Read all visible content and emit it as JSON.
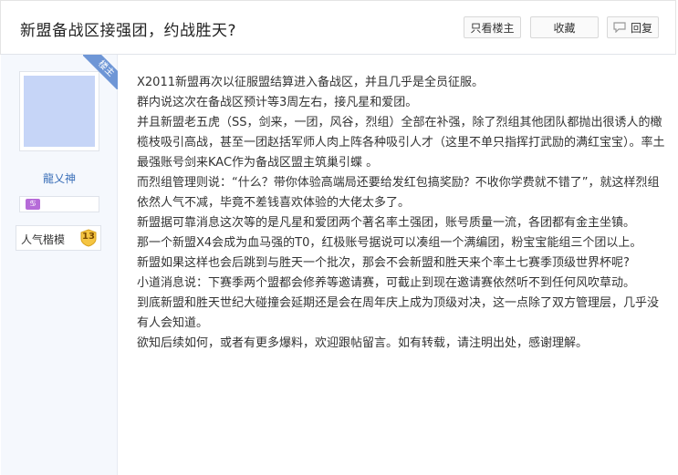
{
  "thread": {
    "title": "新盟备战区接强团，约战胜天?"
  },
  "toolbar": {
    "only_author_label": "只看楼主",
    "favorite_label": "收藏",
    "reply_label": "回复"
  },
  "author": {
    "badge": "楼主",
    "username": "龍乂神",
    "level_icon": "zodiac-icon",
    "popularity_label": "人气楷模",
    "popularity_value": "13"
  },
  "post": {
    "paragraphs": [
      "X2011新盟再次以征服盟结算进入备战区，并且几乎是全员征服。",
      "群内说这次在备战区预计等3周左右，接凡星和爱团。",
      "并且新盟老五虎（SS，剑来，一团，风谷，烈组）全部在补强，除了烈组其他团队都抛出很诱人的橄榄枝吸引高战，甚至一团赵括军师人肉上阵各种吸引人才（这里不单只指挥打武励的满红宝宝）。率土最强账号剑来KAC作为备战区盟主筑巢引蝶 。",
      "而烈组管理则说：“什么？带你体验高端局还要给发红包搞奖励？不收你学费就不错了”，就这样烈组依然人气不减，毕竟不差钱喜欢体验的大佬太多了。",
      "新盟据可靠消息这次等的是凡星和爱团两个著名率土强团，账号质量一流，各团都有金主坐镇。",
      "那一个新盟X4会成为血马强的T0，红极账号据说可以凑组一个满编团，粉宝宝能组三个团以上。",
      "新盟如果这样也会后跳到与胜天一个批次，那会不会新盟和胜天来个率土七赛季顶级世界杯呢?",
      "小道消息说：下赛季两个盟都会修养等邀请赛，可截止到现在邀请赛依然听不到任何风吹草动。",
      "到底新盟和胜天世纪大碰撞会延期还是会在周年庆上成为顶级对决，这一点除了双方管理层，几乎没有人会知道。",
      "欲知后续如何，或者有更多爆料，欢迎跟帖留言。如有转载，请注明出处，感谢理解。"
    ]
  },
  "colors": {
    "accent_blue": "#6e96d6",
    "username_blue": "#3a6fb8",
    "sidebar_bg": "#f5f8fd",
    "avatar_bg": "#c6d5f7",
    "badge_gold": "#f5c542"
  }
}
